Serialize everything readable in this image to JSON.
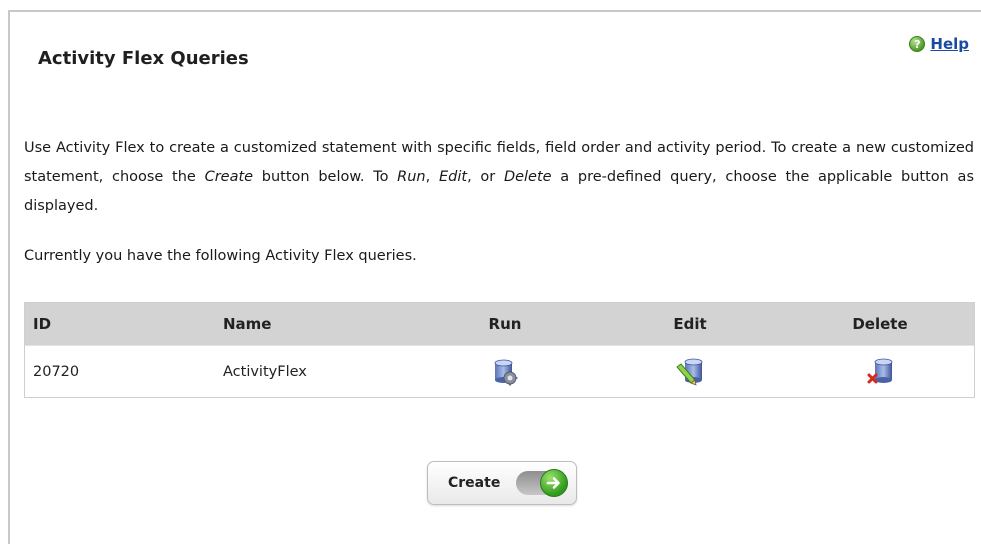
{
  "page": {
    "title": "Activity Flex Queries",
    "help_label": "Help"
  },
  "description": {
    "part1": "Use Activity Flex to create a customized statement with specific fields, field order and activity period. To create a new customized statement, choose the ",
    "create_word": "Create",
    "part2": " button below. To ",
    "run_word": "Run",
    "sep1": ", ",
    "edit_word": "Edit",
    "sep2": ", or ",
    "delete_word": "Delete",
    "part3": " a pre-defined query, choose the applicable button as displayed."
  },
  "currently_text": "Currently you have the following Activity Flex queries.",
  "table": {
    "headers": {
      "id": "ID",
      "name": "Name",
      "run": "Run",
      "edit": "Edit",
      "delete": "Delete"
    },
    "rows": [
      {
        "id": "20720",
        "name": "ActivityFlex"
      }
    ]
  },
  "icons": {
    "help": "help-icon",
    "run": "run-query-icon",
    "edit": "edit-query-icon",
    "delete": "delete-query-icon",
    "create_arrow": "arrow-right-icon"
  },
  "create_button": {
    "label": "Create"
  },
  "colors": {
    "link": "#1a4aa0",
    "header_bg": "#d3d3d3",
    "accent_green": "#2d9a1c"
  }
}
